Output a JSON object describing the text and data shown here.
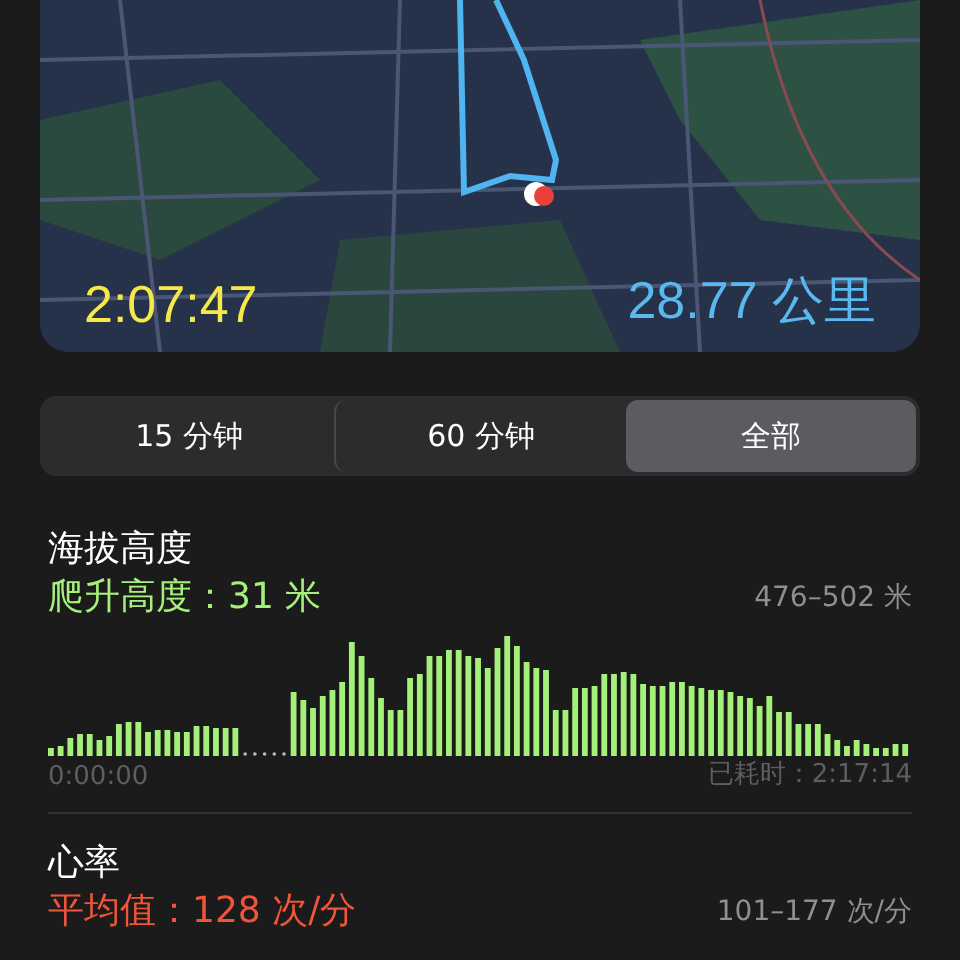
{
  "map": {
    "duration": "2:07:47",
    "distance": "28.77 公里"
  },
  "segments": [
    {
      "label": "15 分钟",
      "selected": false
    },
    {
      "label": "60 分钟",
      "selected": false
    },
    {
      "label": "全部",
      "selected": true
    }
  ],
  "elevation": {
    "title": "海拔高度",
    "summary": "爬升高度：31 米",
    "range": "476–502 米",
    "start_time": "0:00:00",
    "elapsed": "已耗时：2:17:14"
  },
  "heart_rate": {
    "title": "心率",
    "summary": "平均值：128 次/分",
    "range": "101–177 次/分"
  }
}
